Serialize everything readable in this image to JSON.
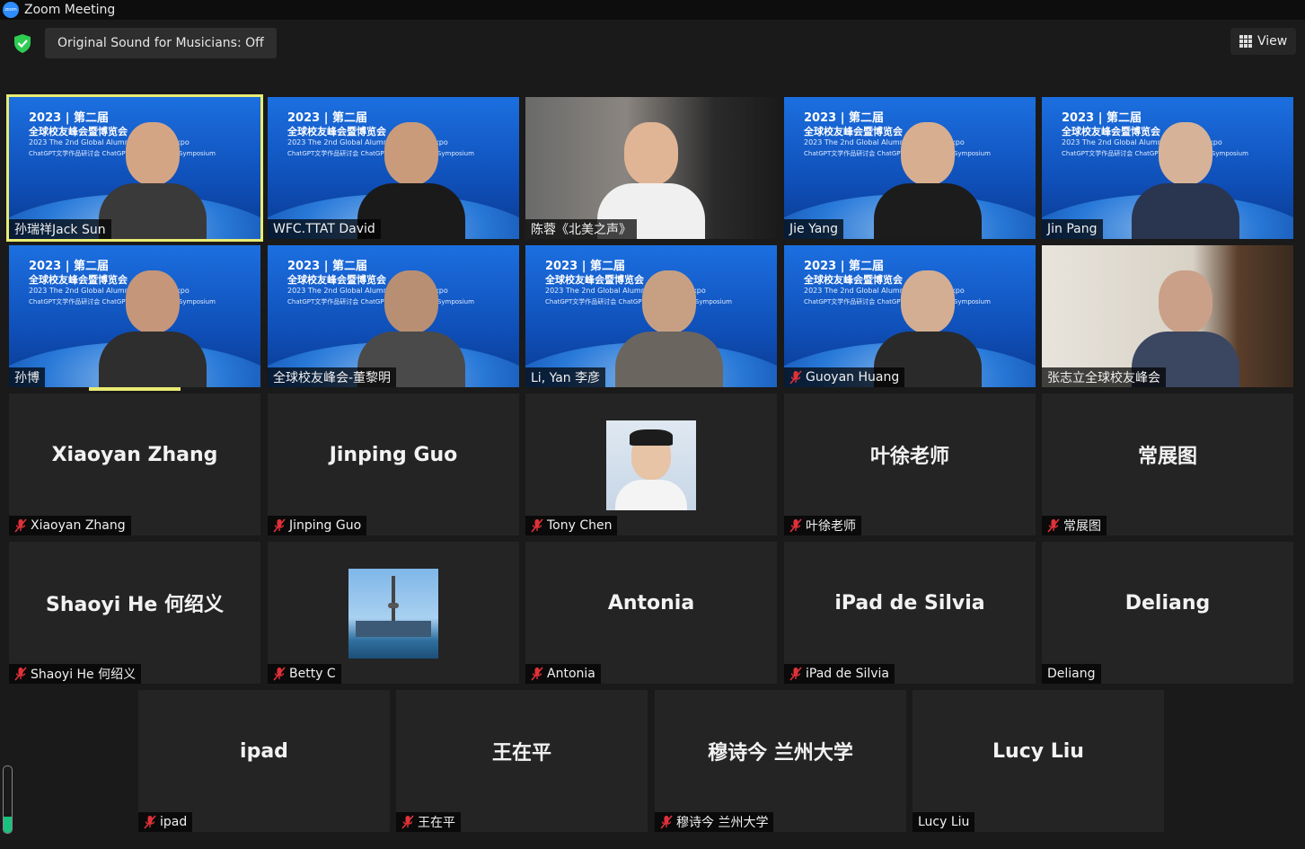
{
  "window": {
    "title": "Zoom Meeting",
    "logo_text": "zoom"
  },
  "toolbar": {
    "sound_button": "Original Sound for Musicians: Off",
    "view_button": "View"
  },
  "banner": {
    "line1": "2023 | 第二届",
    "line2": "全球校友峰会暨博览会",
    "line3": "2023 The 2nd Global Alumni Summit & Expo",
    "line4": "ChatGPT文学作品研讨会 ChatGPT Literary Works Symposium"
  },
  "participants": [
    {
      "name": "孙瑞祥Jack Sun",
      "muted": false,
      "kind": "video"
    },
    {
      "name": "WFC.TTAT David",
      "muted": false,
      "kind": "video"
    },
    {
      "name": "陈蓉《北美之声》",
      "muted": false,
      "kind": "video"
    },
    {
      "name": "Jie Yang",
      "muted": false,
      "kind": "video"
    },
    {
      "name": "Jin Pang",
      "muted": false,
      "kind": "video"
    },
    {
      "name": "孙博",
      "muted": false,
      "kind": "video"
    },
    {
      "name": "全球校友峰会-董黎明",
      "muted": false,
      "kind": "video"
    },
    {
      "name": "Li, Yan 李彦",
      "muted": false,
      "kind": "video"
    },
    {
      "name": "Guoyan Huang",
      "muted": true,
      "kind": "video"
    },
    {
      "name": "张志立全球校友峰会",
      "muted": false,
      "kind": "video"
    },
    {
      "name": "Xiaoyan Zhang",
      "display": "Xiaoyan Zhang",
      "muted": true,
      "kind": "name"
    },
    {
      "name": "Jinping Guo",
      "display": "Jinping Guo",
      "muted": true,
      "kind": "name"
    },
    {
      "name": "Tony Chen",
      "muted": true,
      "kind": "photo"
    },
    {
      "name": "叶徐老师",
      "display": "叶徐老师",
      "muted": true,
      "kind": "name"
    },
    {
      "name": "常展图",
      "display": "常展图",
      "muted": true,
      "kind": "name"
    },
    {
      "name": "Shaoyi He 何绍义",
      "display": "Shaoyi He 何绍义",
      "muted": true,
      "kind": "name"
    },
    {
      "name": "Betty C",
      "muted": true,
      "kind": "photo"
    },
    {
      "name": "Antonia",
      "display": "Antonia",
      "muted": true,
      "kind": "name"
    },
    {
      "name": "iPad de Silvia",
      "display": "iPad de Silvia",
      "muted": true,
      "kind": "name"
    },
    {
      "name": "Deliang",
      "display": "Deliang",
      "muted": false,
      "kind": "name"
    },
    {
      "name": "ipad",
      "display": "ipad",
      "muted": true,
      "kind": "name"
    },
    {
      "name": "王在平",
      "display": "王在平",
      "muted": true,
      "kind": "name"
    },
    {
      "name": "穆诗今 兰州大学",
      "display": "穆诗今 兰州大学",
      "muted": true,
      "kind": "name"
    },
    {
      "name": "Lucy Liu",
      "display": "Lucy Liu",
      "muted": false,
      "kind": "name"
    }
  ],
  "audio_level": 0.25,
  "colors": {
    "active_speaker": "#e9ec72",
    "muted_mic": "#e0313a",
    "shield": "#2ecc52"
  }
}
